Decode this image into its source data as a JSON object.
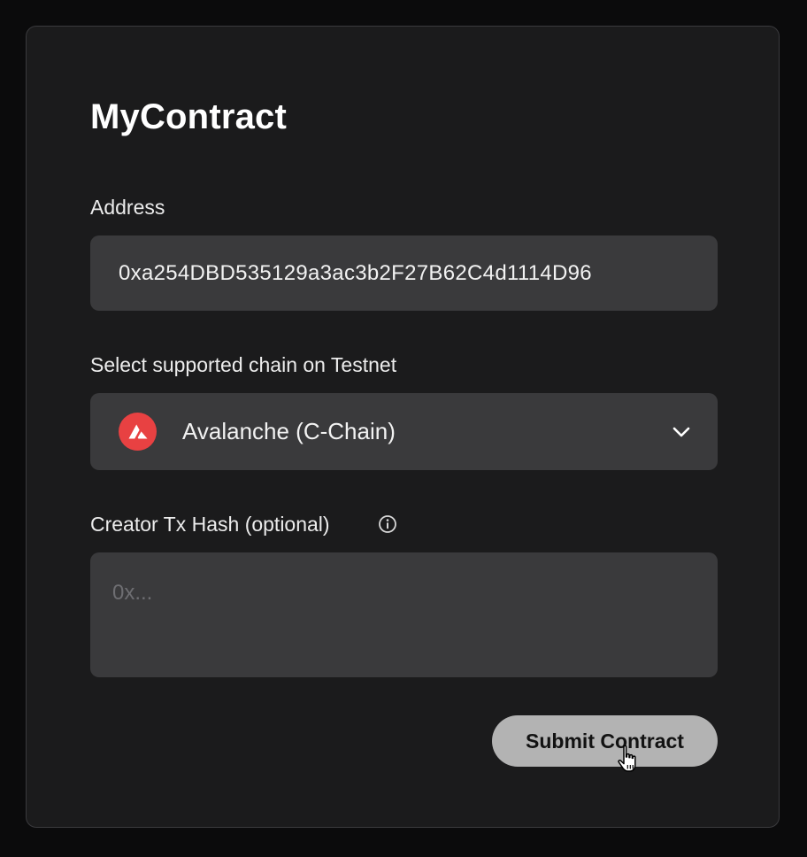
{
  "card": {
    "title": "MyContract"
  },
  "address": {
    "label": "Address",
    "value": "0xa254DBD535129a3ac3b2F27B62C4d1114D96"
  },
  "chain": {
    "label": "Select supported chain on Testnet",
    "selected": "Avalanche (C-Chain)",
    "icon": "avalanche-logo-icon",
    "accent": "#e84142"
  },
  "creator_tx": {
    "label": "Creator Tx Hash (optional)",
    "placeholder": "0x..."
  },
  "submit": {
    "label": "Submit Contract"
  }
}
